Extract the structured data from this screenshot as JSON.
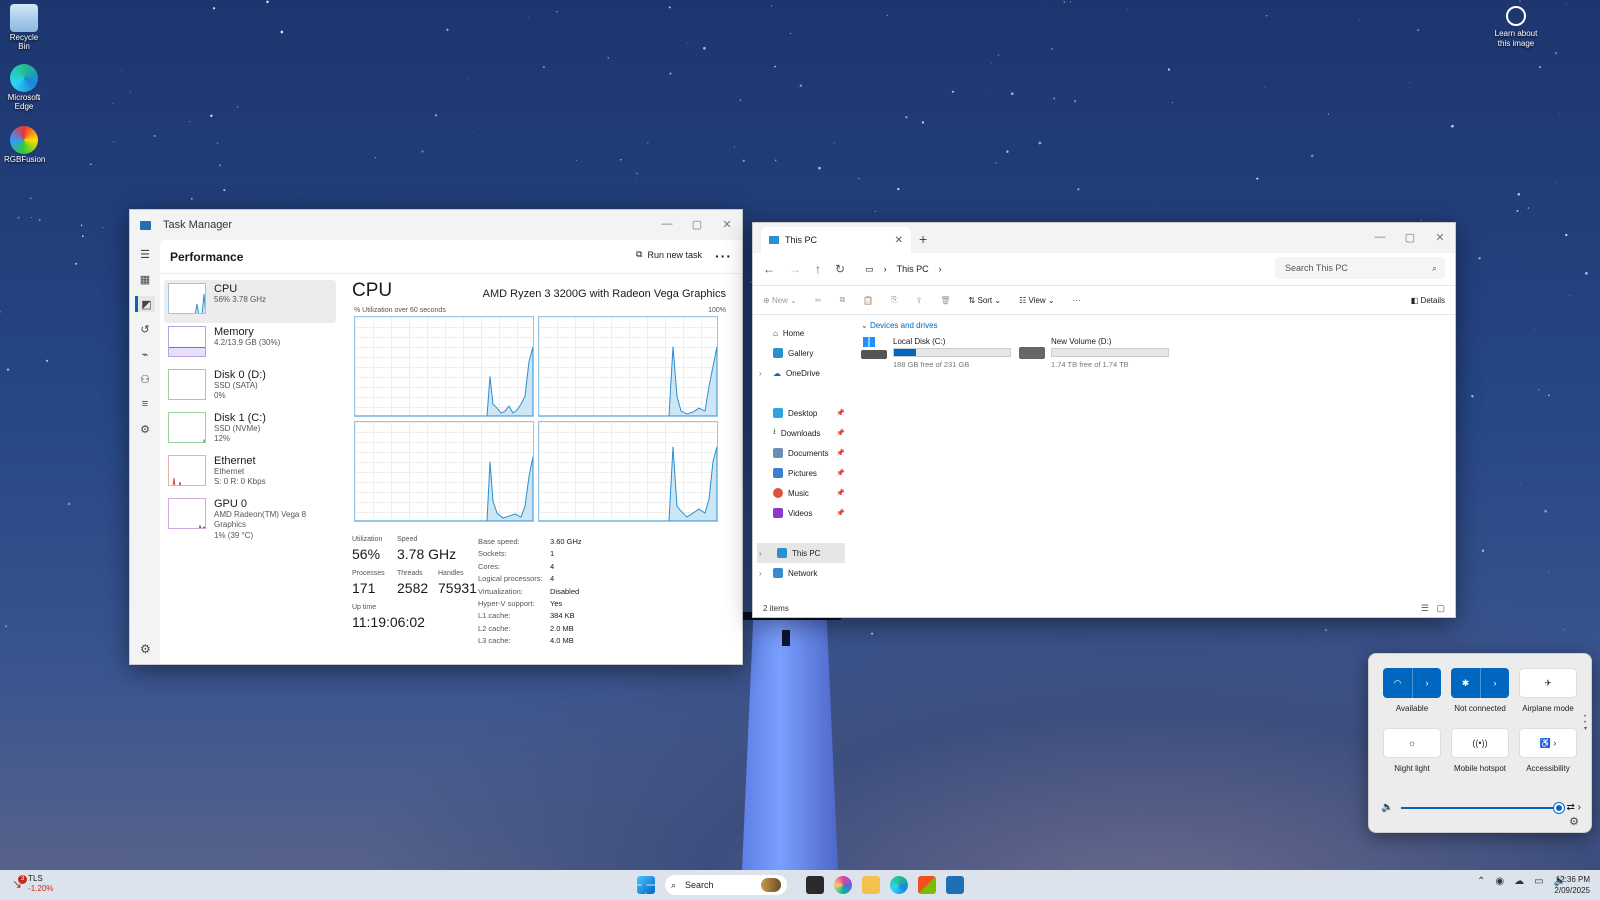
{
  "desktop": {
    "icons": [
      {
        "label": "Recycle Bin"
      },
      {
        "label": "Microsoft Edge"
      },
      {
        "label": "RGBFusion"
      }
    ],
    "learn_label": "Learn about this image"
  },
  "task_manager": {
    "title": "Task Manager",
    "page": "Performance",
    "run_new_task": "Run new task",
    "resources": [
      {
        "name": "CPU",
        "sub1": "56%  3.78 GHz",
        "sub2": ""
      },
      {
        "name": "Memory",
        "sub1": "4.2/13.9 GB (30%)",
        "sub2": ""
      },
      {
        "name": "Disk 0 (D:)",
        "sub1": "SSD (SATA)",
        "sub2": "0%"
      },
      {
        "name": "Disk 1 (C:)",
        "sub1": "SSD (NVMe)",
        "sub2": "12%"
      },
      {
        "name": "Ethernet",
        "sub1": "Ethernet",
        "sub2": "S: 0  R: 0 Kbps"
      },
      {
        "name": "GPU 0",
        "sub1": "AMD Radeon(TM) Vega 8 Graphics",
        "sub2": "1%  (39 °C)"
      }
    ],
    "cpu": {
      "title": "CPU",
      "model": "AMD Ryzen 3 3200G with Radeon Vega Graphics",
      "util_label": "% Utilization over 60 seconds",
      "util_max": "100%",
      "utilization_label": "Utilization",
      "utilization": "56%",
      "speed_label": "Speed",
      "speed": "3.78 GHz",
      "processes_label": "Processes",
      "processes": "171",
      "threads_label": "Threads",
      "threads": "2582",
      "handles_label": "Handles",
      "handles": "75931",
      "uptime_label": "Up time",
      "uptime": "11:19:06:02",
      "specs": [
        {
          "k": "Base speed:",
          "v": "3.60 GHz"
        },
        {
          "k": "Sockets:",
          "v": "1"
        },
        {
          "k": "Cores:",
          "v": "4"
        },
        {
          "k": "Logical processors:",
          "v": "4"
        },
        {
          "k": "Virtualization:",
          "v": "Disabled"
        },
        {
          "k": "Hyper-V support:",
          "v": "Yes"
        },
        {
          "k": "L1 cache:",
          "v": "384 KB"
        },
        {
          "k": "L2 cache:",
          "v": "2.0 MB"
        },
        {
          "k": "L3 cache:",
          "v": "4.0 MB"
        }
      ]
    }
  },
  "explorer": {
    "tab_title": "This PC",
    "breadcrumb": "This PC",
    "search_placeholder": "Search This PC",
    "cmd": {
      "new": "New",
      "sort": "Sort",
      "view": "View",
      "details": "Details"
    },
    "nav": {
      "home": "Home",
      "gallery": "Gallery",
      "onedrive": "OneDrive",
      "desktop": "Desktop",
      "downloads": "Downloads",
      "documents": "Documents",
      "pictures": "Pictures",
      "music": "Music",
      "videos": "Videos",
      "thispc": "This PC",
      "network": "Network"
    },
    "section": "Devices and drives",
    "drives": [
      {
        "name": "Local Disk (C:)",
        "free": "188 GB free of 231 GB",
        "used_fraction": 0.19
      },
      {
        "name": "New Volume (D:)",
        "free": "1.74 TB free of 1.74 TB",
        "used_fraction": 0.0
      }
    ],
    "status": "2 items"
  },
  "quick_settings": {
    "wifi_label": "Available",
    "bluetooth_label": "Not connected",
    "airplane_label": "Airplane mode",
    "night_label": "Night light",
    "hotspot_label": "Mobile hotspot",
    "accessibility_label": "Accessibility",
    "volume_level": 1.0
  },
  "taskbar": {
    "stock_symbol": "TLS",
    "stock_change": "-1.20%",
    "stock_badge": "3",
    "search_label": "Search",
    "time": "12:36 PM",
    "date": "2/09/2025"
  }
}
